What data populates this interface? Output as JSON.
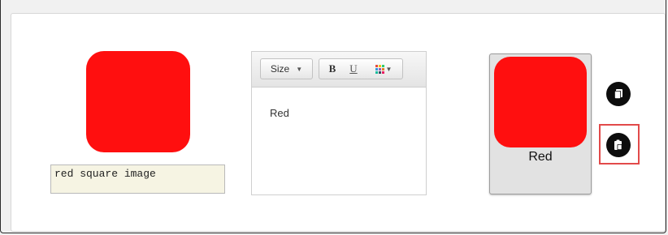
{
  "image_block": {
    "tile_color": "#ff0f0f",
    "alt_text": "red square image"
  },
  "editor": {
    "toolbar": {
      "size_label": "Size",
      "bold_label": "B",
      "underline_label": "U"
    },
    "content": "Red"
  },
  "preview": {
    "tile_color": "#ff0f0f",
    "caption": "Red"
  },
  "actions": {
    "copy_icon": "copy-icon",
    "paste_icon": "paste-icon",
    "highlight_color": "#e24a4a"
  }
}
